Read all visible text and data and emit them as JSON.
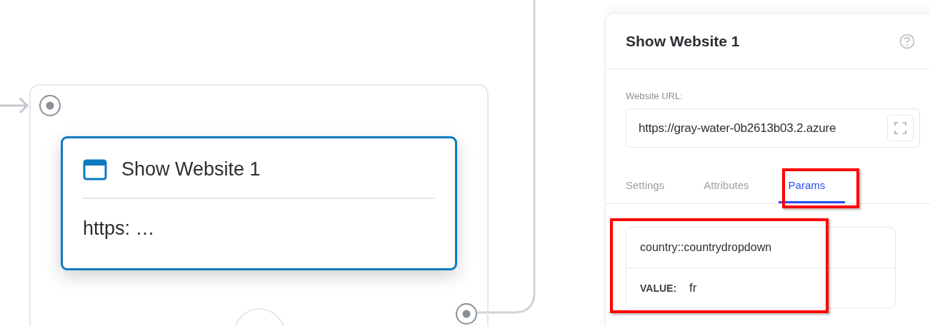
{
  "canvas": {
    "node": {
      "title": "Show Website 1",
      "subtitle": "https: …",
      "selected": true
    }
  },
  "panel": {
    "title": "Show Website 1",
    "url_label": "Website URL:",
    "url_value": "https://gray-water-0b2613b03.2.azure",
    "tabs": [
      {
        "label": "Settings",
        "selected": false,
        "highlighted": false
      },
      {
        "label": "Attributes",
        "selected": false,
        "highlighted": false
      },
      {
        "label": "Params",
        "selected": true,
        "highlighted": true
      }
    ],
    "params": [
      {
        "name": "country::countrydropdown",
        "value_label": "VALUE:",
        "value": "fr",
        "highlighted": true
      }
    ]
  }
}
